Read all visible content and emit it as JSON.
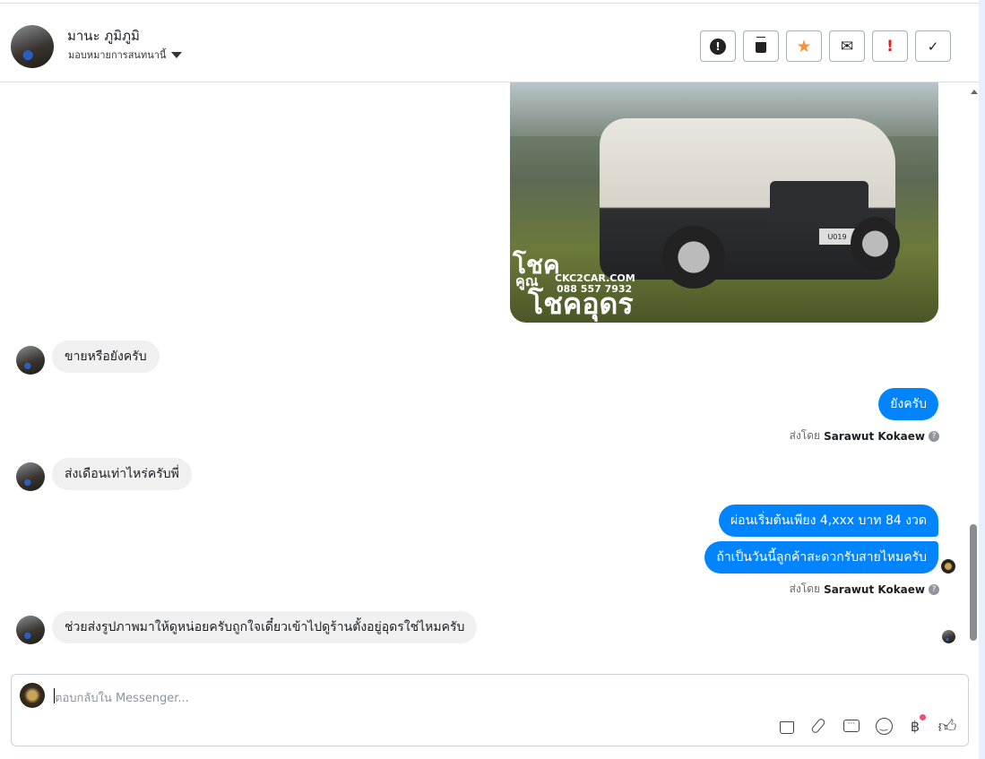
{
  "header": {
    "name": "มานะ ภูมิภูมิ",
    "assign_label": "มอบหมายการสนทนานี้"
  },
  "toolbar": [
    {
      "name": "report-spam-button",
      "icon": "alert-circle-icon",
      "glyph": "!"
    },
    {
      "name": "delete-button",
      "icon": "trash-icon",
      "glyph": "🗑"
    },
    {
      "name": "star-button",
      "icon": "star-icon",
      "glyph": "★"
    },
    {
      "name": "mark-unread-button",
      "icon": "envelope-open-icon",
      "glyph": "✉"
    },
    {
      "name": "follow-up-button",
      "icon": "exclamation-icon",
      "glyph": "!"
    },
    {
      "name": "mark-done-button",
      "icon": "check-icon",
      "glyph": "✓"
    }
  ],
  "image_ad": {
    "brand_line1": "โชค",
    "brand_line2": "คูณ",
    "brand_line3": "โชคอุดร",
    "website": "CKC2CAR.COM",
    "phone": "088 557 7932",
    "plate": "U019"
  },
  "messages": [
    {
      "dir": "in",
      "text": "ขายหรือยังครับ"
    },
    {
      "dir": "out",
      "text": "ยังครับ"
    },
    {
      "dir": "in",
      "text": "ส่งเดือนเท่าไหร่ครับพี่"
    },
    {
      "dir": "out",
      "text": "ผ่อนเริ่มต้นเพียง 4,xxx บาท 84 งวด"
    },
    {
      "dir": "out",
      "text": "ถ้าเป็นวันนี้ลูกค้าสะดวกรับสายไหมครับ"
    },
    {
      "dir": "in",
      "text": "ช่วยส่งรูปภาพมาให้ดูหน่อยครับถูกใจเดี๋ยวเข้าไปดูร้านตั้งอยู่อุดรใช่ไหมครับ"
    }
  ],
  "sent_by": {
    "prefix": "ส่งโดย",
    "name": "Sarawut Kokaew",
    "help": "?"
  },
  "composer": {
    "placeholder": "ตอบกลับใน Messenger...",
    "baht_glyph": "฿"
  },
  "colors": {
    "accent": "#0084ff",
    "star": "#f7923a",
    "follow": "#e02020"
  }
}
